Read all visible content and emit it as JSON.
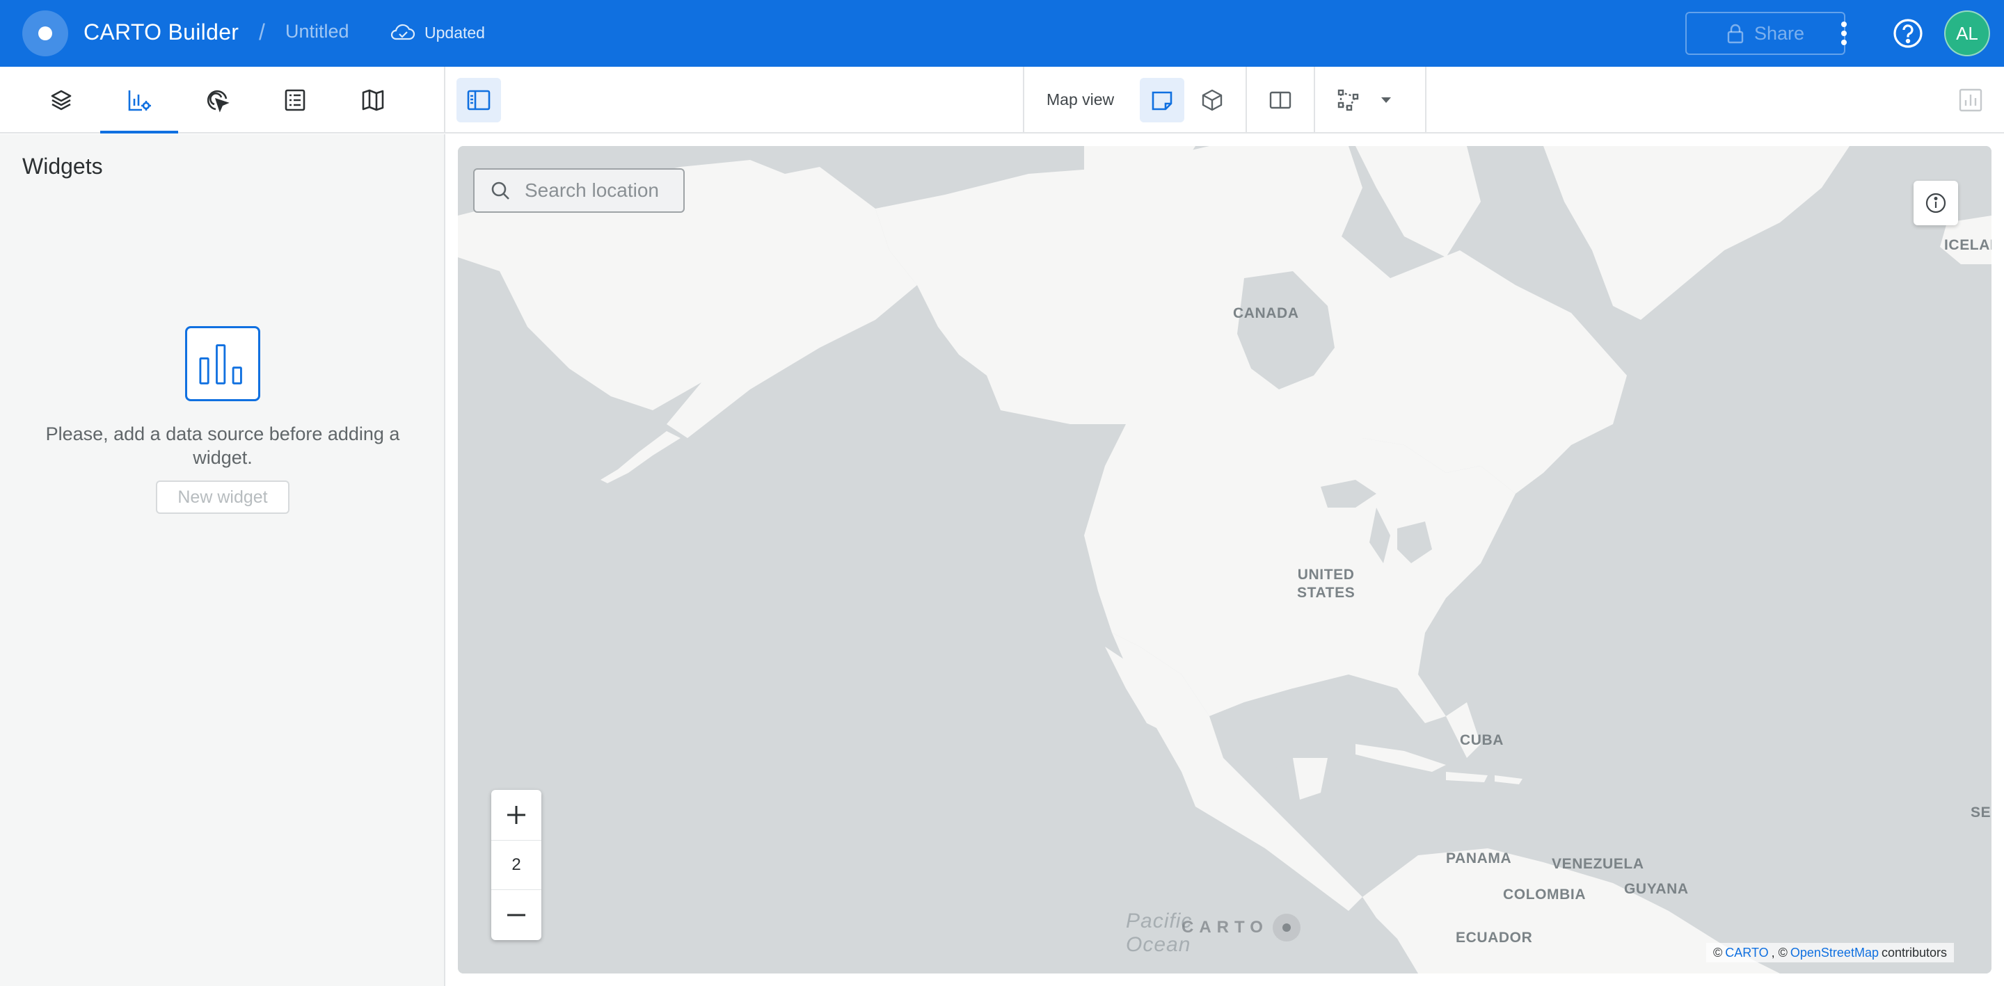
{
  "appbar": {
    "title": "CARTO Builder",
    "separator": "/",
    "map_name": "Untitled",
    "save_status": "Updated",
    "share_label": "Share",
    "avatar_initials": "AL",
    "colors": {
      "primary": "#1070e0",
      "avatar": "#27b587"
    }
  },
  "toolbar": {
    "tabs": [
      {
        "icon": "layers-icon",
        "active": false
      },
      {
        "icon": "widgets-icon",
        "active": true
      },
      {
        "icon": "interactions-icon",
        "active": false
      },
      {
        "icon": "legend-icon",
        "active": false
      },
      {
        "icon": "basemap-icon",
        "active": false
      }
    ],
    "view_label": "Map view",
    "view_modes": [
      "2d-view-icon",
      "3d-view-icon",
      "split-view-icon",
      "draw-icon"
    ]
  },
  "sidebar": {
    "title": "Widgets",
    "empty_message": "Please, add a data source before adding a widget.",
    "new_widget_label": "New widget"
  },
  "map": {
    "search_placeholder": "Search location",
    "zoom_level": "2",
    "labels": {
      "canada": "CANADA",
      "us_line1": "UNITED",
      "us_line2": "STATES",
      "cuba": "CUBA",
      "panama": "PANAMA",
      "venezuela": "VENEZUELA",
      "colombia": "COLOMBIA",
      "guyana": "GUYANA",
      "ecuador": "ECUADOR",
      "iceland": "ICELAN",
      "se": "SE"
    },
    "ocean_line1": "Pacific",
    "ocean_line2": "Ocean",
    "watermark": "CARTO",
    "attribution": {
      "prefix": "©",
      "carto": "CARTO",
      "mid": ", ©",
      "osm": "OpenStreetMap",
      "suffix": "contributors"
    },
    "colors": {
      "water": "#d4d8da",
      "land": "#f6f6f5"
    }
  }
}
